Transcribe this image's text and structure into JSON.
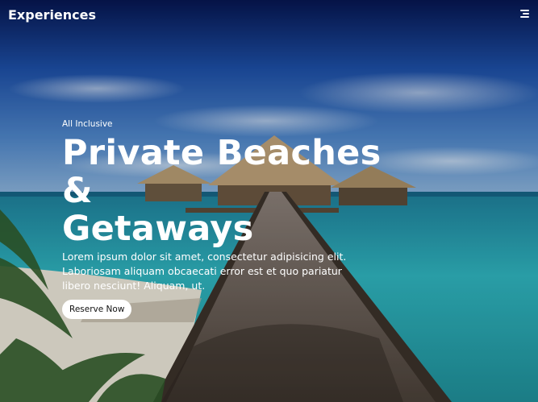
{
  "nav": {
    "brand": "Experiences",
    "menu_icon": "hamburger-menu-icon"
  },
  "hero": {
    "eyebrow": "All Inclusive",
    "headline_line1": "Private Beaches &",
    "headline_line2": "Getaways",
    "description": "Lorem ipsum dolor sit amet, consectetur adipisicing elit. Laboriosam aliquam obcaecati error est et quo pariatur libero nesciunt! Aliquam, ut.",
    "cta_label": "Reserve Now"
  },
  "colors": {
    "sky_top": "#0a1d5c",
    "sea": "#2fb5c0",
    "text": "#ffffff",
    "button_bg": "#ffffff"
  }
}
